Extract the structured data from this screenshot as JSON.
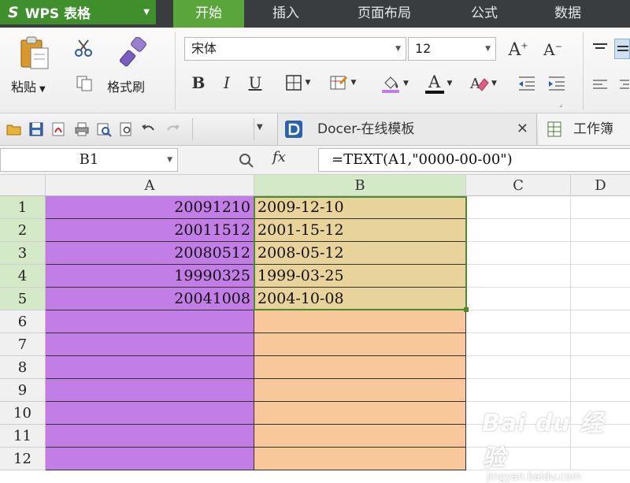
{
  "app": {
    "logo": "S",
    "title": "WPS 表格"
  },
  "menu": {
    "tabs": [
      "开始",
      "插入",
      "页面布局",
      "公式",
      "数据"
    ],
    "active_index": 0
  },
  "ribbon": {
    "paste_label": "粘贴",
    "format_painter_label": "格式刷",
    "font_name": "宋体",
    "font_size": "12",
    "bold": "B",
    "italic": "I",
    "underline": "U",
    "font_color_glyph": "A"
  },
  "qat": {
    "doc_tab": "Docer-在线模板",
    "workbook_tab": "工作簿"
  },
  "formula_bar": {
    "cell_ref": "B1",
    "fx": "fx",
    "formula": "=TEXT(A1,\"0000-00-00\")"
  },
  "grid": {
    "columns": [
      "A",
      "B",
      "C",
      "D"
    ],
    "selected_column": "B",
    "rows": [
      {
        "num": "1",
        "a": "20091210",
        "b": "2009-12-10"
      },
      {
        "num": "2",
        "a": "20011512",
        "b": "2001-15-12"
      },
      {
        "num": "3",
        "a": "20080512",
        "b": "2008-05-12"
      },
      {
        "num": "4",
        "a": "19990325",
        "b": "1999-03-25"
      },
      {
        "num": "5",
        "a": "20041008",
        "b": "2004-10-08"
      },
      {
        "num": "6",
        "a": "",
        "b": ""
      },
      {
        "num": "7",
        "a": "",
        "b": ""
      },
      {
        "num": "8",
        "a": "",
        "b": ""
      },
      {
        "num": "9",
        "a": "",
        "b": ""
      },
      {
        "num": "10",
        "a": "",
        "b": ""
      },
      {
        "num": "11",
        "a": "",
        "b": ""
      },
      {
        "num": "12",
        "a": "",
        "b": ""
      }
    ]
  },
  "colors": {
    "brand_green": "#3f8f2c",
    "col_a_fill": "#c27de7",
    "col_b_fill": "#f8c79a",
    "selection": "#4b8a2e"
  },
  "watermark": {
    "main": "Bai du 经验",
    "sub": "jingyan.baidu.com"
  }
}
